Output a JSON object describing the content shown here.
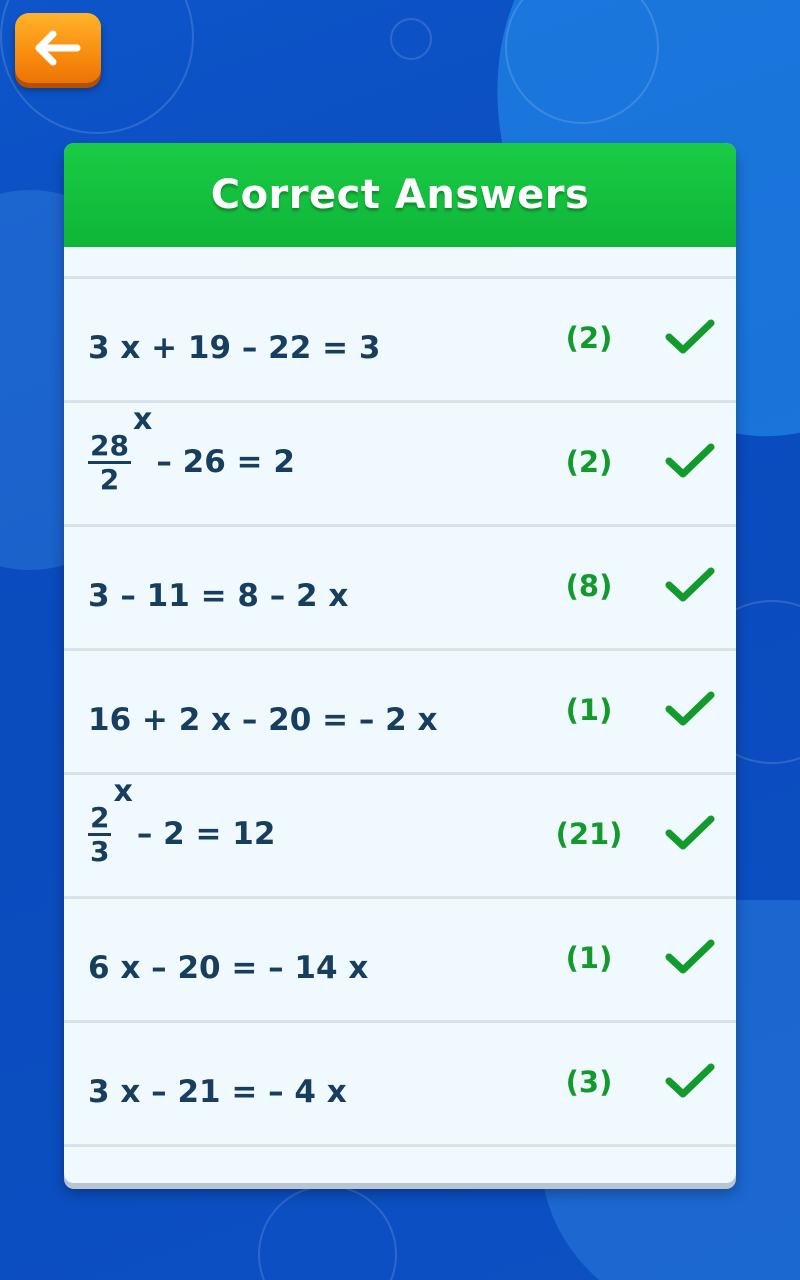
{
  "header": {
    "title": "Correct Answers"
  },
  "nav": {
    "back_icon": "arrow-left-icon"
  },
  "colors": {
    "header_green": "#14c03e",
    "answer_green": "#129a2c",
    "back_orange": "#f98c0e",
    "equation_text": "#173e5f",
    "background_blue": "#0c4fc4"
  },
  "answers": [
    {
      "equation": "3 x + 19 – 22 = 3",
      "answer": "(2)",
      "status_icon": "check-icon"
    },
    {
      "fraction": {
        "numerator": "28",
        "variable": "x",
        "denominator": "2"
      },
      "rest": "– 26 = 2",
      "answer": "(2)",
      "status_icon": "check-icon"
    },
    {
      "equation": "3 – 11 = 8 – 2 x",
      "answer": "(8)",
      "status_icon": "check-icon"
    },
    {
      "equation": "16 + 2 x – 20 = – 2 x",
      "answer": "(1)",
      "status_icon": "check-icon"
    },
    {
      "fraction": {
        "numerator": "2",
        "variable": "x",
        "denominator": "3"
      },
      "rest": "– 2 = 12",
      "answer": "(21)",
      "status_icon": "check-icon"
    },
    {
      "equation": "6 x – 20 = – 14 x",
      "answer": "(1)",
      "status_icon": "check-icon"
    },
    {
      "equation": "3 x – 21 = – 4 x",
      "answer": "(3)",
      "status_icon": "check-icon"
    }
  ]
}
